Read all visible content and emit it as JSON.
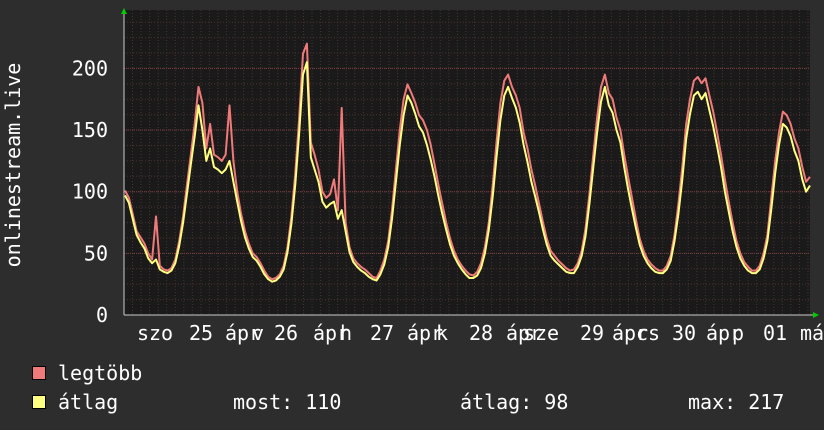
{
  "chart_data": {
    "type": "line",
    "ylabel": "onlinestream.live",
    "ylim": [
      0,
      250
    ],
    "y_ticks": [
      0,
      50,
      100,
      150,
      200
    ],
    "x_labels": [
      "szo",
      "25",
      "ápr",
      "v",
      "26",
      "ápr",
      "h",
      "27",
      "ápr",
      "k",
      "28",
      "ápr",
      "sze",
      "29",
      "ápr",
      "cs",
      "30",
      "ápr",
      "p",
      "01",
      "máj"
    ],
    "series": [
      {
        "name": "legtöbb",
        "color": "#f07a7a",
        "values": [
          101,
          95,
          82,
          68,
          63,
          58,
          50,
          45,
          80,
          40,
          37,
          36,
          38,
          45,
          60,
          80,
          105,
          130,
          155,
          185,
          172,
          135,
          155,
          130,
          128,
          125,
          130,
          170,
          125,
          100,
          82,
          68,
          58,
          50,
          47,
          42,
          36,
          31,
          29,
          30,
          33,
          40,
          55,
          80,
          115,
          160,
          212,
          220,
          140,
          130,
          118,
          100,
          95,
          98,
          110,
          85,
          168,
          75,
          55,
          46,
          42,
          39,
          37,
          34,
          31,
          30,
          36,
          45,
          60,
          85,
          118,
          150,
          175,
          187,
          180,
          172,
          162,
          158,
          150,
          138,
          122,
          105,
          90,
          75,
          62,
          52,
          45,
          40,
          36,
          33,
          32,
          35,
          42,
          55,
          75,
          105,
          140,
          172,
          190,
          195,
          185,
          178,
          168,
          148,
          135,
          118,
          105,
          90,
          75,
          62,
          52,
          48,
          44,
          41,
          38,
          36,
          37,
          42,
          52,
          70,
          98,
          130,
          160,
          185,
          195,
          180,
          175,
          160,
          150,
          130,
          112,
          95,
          78,
          62,
          52,
          45,
          41,
          38,
          36,
          36,
          40,
          48,
          65,
          90,
          120,
          155,
          175,
          190,
          193,
          188,
          192,
          178,
          165,
          148,
          130,
          110,
          92,
          75,
          60,
          50,
          43,
          39,
          36,
          36,
          40,
          50,
          65,
          95,
          125,
          148,
          165,
          162,
          155,
          143,
          135,
          120,
          108,
          112
        ]
      },
      {
        "name": "átlag",
        "color": "#ffff80",
        "values": [
          97,
          91,
          78,
          65,
          59,
          54,
          46,
          42,
          45,
          37,
          35,
          34,
          36,
          42,
          56,
          75,
          98,
          122,
          145,
          170,
          150,
          125,
          135,
          120,
          118,
          115,
          118,
          125,
          108,
          92,
          76,
          63,
          54,
          47,
          44,
          39,
          33,
          29,
          27,
          28,
          31,
          37,
          51,
          74,
          106,
          148,
          195,
          205,
          128,
          118,
          108,
          92,
          87,
          90,
          92,
          78,
          85,
          68,
          51,
          43,
          39,
          36,
          34,
          31,
          29,
          28,
          33,
          41,
          55,
          78,
          108,
          138,
          162,
          178,
          172,
          163,
          153,
          148,
          138,
          126,
          112,
          96,
          82,
          69,
          57,
          48,
          42,
          37,
          33,
          30,
          30,
          32,
          38,
          50,
          69,
          96,
          128,
          158,
          178,
          185,
          176,
          168,
          156,
          138,
          124,
          108,
          96,
          83,
          69,
          57,
          48,
          44,
          41,
          38,
          35,
          34,
          34,
          39,
          48,
          64,
          90,
          120,
          148,
          173,
          185,
          170,
          164,
          150,
          140,
          120,
          102,
          86,
          71,
          57,
          48,
          42,
          38,
          35,
          34,
          34,
          37,
          44,
          60,
          82,
          110,
          143,
          163,
          178,
          181,
          175,
          180,
          166,
          153,
          137,
          120,
          100,
          84,
          68,
          55,
          46,
          40,
          36,
          34,
          34,
          37,
          46,
          60,
          86,
          115,
          138,
          155,
          152,
          145,
          133,
          125,
          110,
          100,
          105
        ]
      }
    ]
  },
  "legend": [
    {
      "label": "legtöbb",
      "color": "#f07a7a"
    },
    {
      "label": "átlag",
      "color": "#ffff80"
    }
  ],
  "stats": {
    "now": "most: 110",
    "avg": "átlag: 98",
    "max": "max: 217"
  }
}
